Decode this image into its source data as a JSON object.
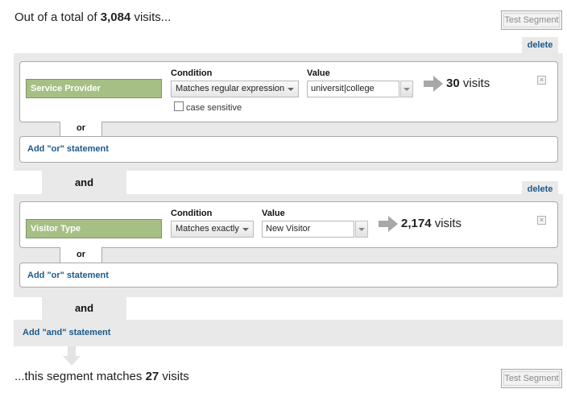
{
  "header": {
    "prefix": "Out of a total of ",
    "total": "3,084",
    "suffix": " visits...",
    "test_segment_label": "Test Segment"
  },
  "conditions": [
    {
      "delete_label": "delete",
      "dimension": "Service Provider",
      "condition_label": "Condition",
      "condition_value": "Matches regular expression",
      "value_label": "Value",
      "value": "universit|college",
      "case_sensitive_label": "case sensitive",
      "case_sensitive_checked": false,
      "count": "30",
      "count_suffix": " visits",
      "or_label": "or",
      "add_or_label": "Add \"or\" statement"
    },
    {
      "delete_label": "delete",
      "dimension": "Visitor Type",
      "condition_label": "Condition",
      "condition_value": "Matches exactly",
      "value_label": "Value",
      "value": "New Visitor",
      "count": "2,174",
      "count_suffix": " visits",
      "or_label": "or",
      "add_or_label": "Add \"or\" statement"
    }
  ],
  "and_label": "and",
  "add_and_label": "Add \"and\" statement",
  "footer": {
    "prefix": "...this segment matches ",
    "count": "27",
    "suffix": " visits",
    "test_segment_label": "Test Segment"
  },
  "icons": {
    "close": "close-x-icon",
    "result_arrow": "right-arrow-icon",
    "flow_arrow": "down-arrow-icon",
    "dropdown": "chevron-down-icon"
  },
  "colors": {
    "dimension_chip": "#a6bf84",
    "link": "#1d5a8a",
    "panel_gray": "#e9e9e9"
  }
}
